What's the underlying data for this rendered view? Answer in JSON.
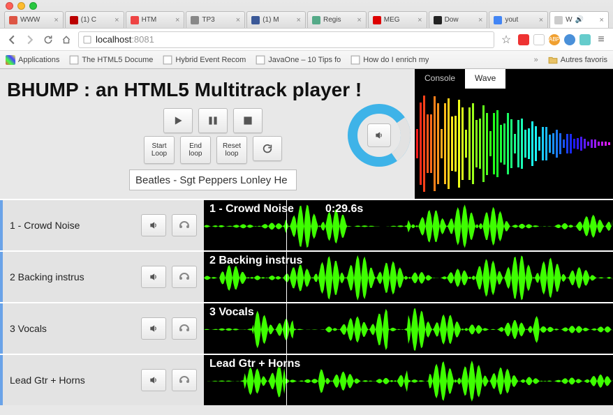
{
  "browser": {
    "tabs": [
      {
        "label": "WWW",
        "fav": "gmail"
      },
      {
        "label": "(1) C",
        "fav": "quora"
      },
      {
        "label": "HTM",
        "fav": "html5"
      },
      {
        "label": "TP3",
        "fav": "gear"
      },
      {
        "label": "(1) M",
        "fav": "fb"
      },
      {
        "label": "Regis",
        "fav": "doc"
      },
      {
        "label": "MEG",
        "fav": "mega"
      },
      {
        "label": "Dow",
        "fav": "dl"
      },
      {
        "label": "yout",
        "fav": "google"
      },
      {
        "label": "W",
        "fav": "blank",
        "active": true,
        "audio": true
      }
    ],
    "url_host": "localhost",
    "url_port": ":8081",
    "bookmarks": [
      {
        "label": "Applications",
        "icon": "apps"
      },
      {
        "label": "The HTML5 Docume",
        "icon": "page"
      },
      {
        "label": "Hybrid Event Recom",
        "icon": "page"
      },
      {
        "label": "JavaOne – 10 Tips fo",
        "icon": "page"
      },
      {
        "label": "How do I enrich my",
        "icon": "page"
      }
    ],
    "other_bookmarks": "Autres favoris"
  },
  "page": {
    "title": "BHUMP : an HTML5 Multitrack player !",
    "transport": {
      "play": "play",
      "pause": "pause",
      "stop": "stop",
      "start_loop": "Start Loop",
      "end_loop": "End loop",
      "reset_loop": "Reset loop",
      "reload": "reload"
    },
    "song_input": "Beatles - Sgt Peppers Lonley He",
    "viz_tabs": {
      "console": "Console",
      "wave": "Wave",
      "active": "wave"
    },
    "volume_icon": "speaker",
    "playhead_time": "0:29.6s",
    "tracks": [
      {
        "name": "1 - Crowd Noise",
        "solo": "speaker",
        "mute": "headphones"
      },
      {
        "name": "2 Backing instrus",
        "solo": "speaker",
        "mute": "headphones"
      },
      {
        "name": "3 Vocals",
        "solo": "speaker",
        "mute": "headphones"
      },
      {
        "name": "Lead Gtr + Horns",
        "solo": "speaker",
        "mute": "headphones"
      }
    ]
  }
}
